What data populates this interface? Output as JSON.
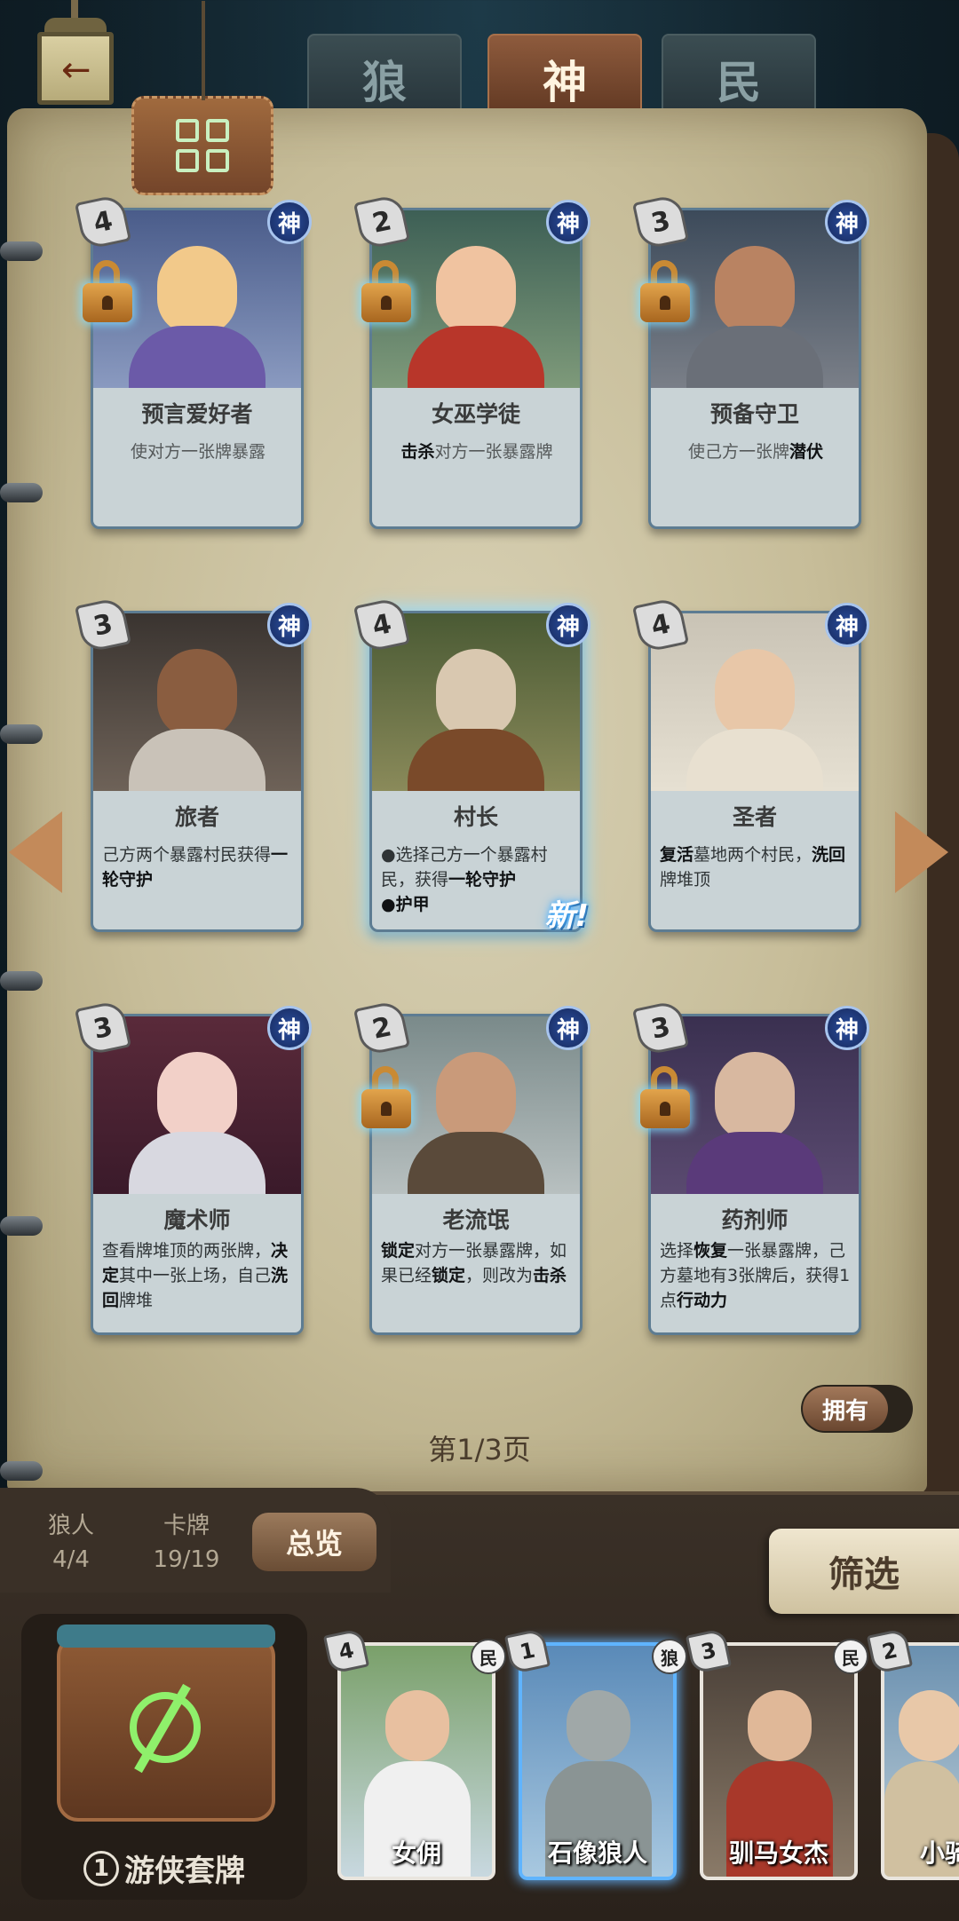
{
  "tabs": [
    {
      "label": "狼"
    },
    {
      "label": "神"
    },
    {
      "label": "民"
    }
  ],
  "active_tab": "神",
  "cards": [
    {
      "name": "预言爱好者",
      "cost": "4",
      "faction": "神",
      "locked": true,
      "desc_plain": "使对方一张牌暴露",
      "colors": [
        "#4a5c8a",
        "#f2c98a",
        "#6b5aa8"
      ]
    },
    {
      "name": "女巫学徒",
      "cost": "2",
      "faction": "神",
      "locked": true,
      "desc_bold": "击杀",
      "desc_rest": "对方一张暴露牌",
      "colors": [
        "#3d5f55",
        "#f0c3a0",
        "#b8362a"
      ]
    },
    {
      "name": "预备守卫",
      "cost": "3",
      "faction": "神",
      "locked": true,
      "desc_pre": "使己方一张牌",
      "desc_bold": "潜伏",
      "colors": [
        "#3c4a5a",
        "#b98362",
        "#6a6f78"
      ]
    },
    {
      "name": "旅者",
      "cost": "3",
      "faction": "神",
      "locked": false,
      "desc_pre": "己方两个暴露村民获得",
      "desc_bold": "一轮守护",
      "colors": [
        "#3a3430",
        "#8a5d40",
        "#c9c2b8"
      ]
    },
    {
      "name": "村长",
      "cost": "4",
      "faction": "神",
      "locked": false,
      "new_label": "新!",
      "line1_pre": "●选择己方一个暴露村民，获得",
      "line1_bold": "一轮守护",
      "line2_bold": "●护甲",
      "colors": [
        "#4a5a34",
        "#d9c8b0",
        "#7a4a2a"
      ]
    },
    {
      "name": "圣者",
      "cost": "4",
      "faction": "神",
      "locked": false,
      "desc_bold1": "复活",
      "desc_mid": "墓地两个村民，",
      "desc_bold2": "洗回",
      "desc_rest": "牌堆顶",
      "colors": [
        "#c9c3b5",
        "#e8c7a8",
        "#e8e0d0"
      ]
    },
    {
      "name": "魔术师",
      "cost": "3",
      "faction": "神",
      "locked": false,
      "desc_pre": "查看牌堆顶的两张牌，",
      "desc_bold1": "决定",
      "desc_mid": "其中一张上场，自己",
      "desc_bold2": "洗回",
      "desc_rest": "牌堆",
      "colors": [
        "#5a2a3a",
        "#f2d0c8",
        "#d8d8e0"
      ]
    },
    {
      "name": "老流氓",
      "cost": "2",
      "faction": "神",
      "locked": true,
      "desc_bold1": "锁定",
      "desc_mid": "对方一张暴露牌，如果已经",
      "desc_bold2": "锁定",
      "desc_mid2": "，则改为",
      "desc_bold3": "击杀",
      "colors": [
        "#7a8a8a",
        "#c99a7a",
        "#5a4a3a"
      ]
    },
    {
      "name": "药剂师",
      "cost": "3",
      "faction": "神",
      "locked": true,
      "desc_pre": "选择",
      "desc_bold1": "恢复",
      "desc_mid": "一张暴露牌，己方墓地有3张牌后，获得1点",
      "desc_bold2": "行动力",
      "colors": [
        "#3a3050",
        "#d8b8a0",
        "#5a3a7a"
      ]
    }
  ],
  "own_toggle_label": "拥有",
  "page_indicator": "第1/3页",
  "stats": {
    "wolf_label": "狼人",
    "wolf_value": "4/4",
    "card_label": "卡牌",
    "card_value": "19/19"
  },
  "overview_label": "总览",
  "filter_label": "筛选",
  "deck": {
    "number": "1",
    "name": "游侠套牌"
  },
  "deck_cards": [
    {
      "name": "女佣",
      "cost": "4",
      "faction": "民"
    },
    {
      "name": "石像狼人",
      "cost": "1",
      "faction": "狼"
    },
    {
      "name": "驯马女杰",
      "cost": "3",
      "faction": "民"
    },
    {
      "name": "小骑",
      "cost": "2",
      "faction": "民"
    }
  ]
}
